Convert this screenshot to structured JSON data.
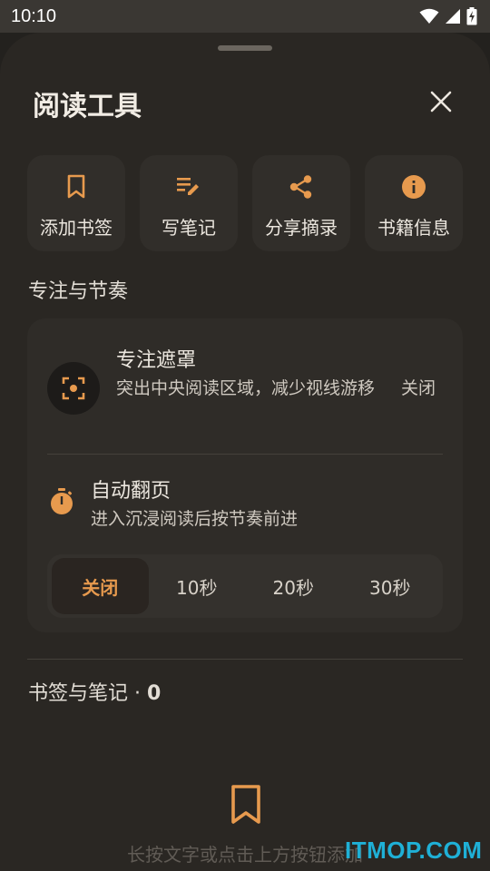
{
  "status_bar": {
    "time": "10:10"
  },
  "sheet": {
    "title": "阅读工具"
  },
  "tools": [
    {
      "label": "添加书签",
      "icon": "bookmark-icon"
    },
    {
      "label": "写笔记",
      "icon": "edit-note-icon"
    },
    {
      "label": "分享摘录",
      "icon": "share-icon"
    },
    {
      "label": "书籍信息",
      "icon": "info-icon"
    }
  ],
  "focus_section": {
    "title": "专注与节奏",
    "mask": {
      "title": "专注遮罩",
      "desc": "突出中央阅读区域，减少视线游移",
      "toggle": "关闭"
    },
    "auto_page": {
      "title": "自动翻页",
      "desc": "进入沉浸阅读后按节奏前进",
      "options": [
        "关闭",
        "10秒",
        "20秒",
        "30秒"
      ],
      "selected": "关闭"
    }
  },
  "bookmarks_section": {
    "title": "书签与笔记 · ",
    "count": "0",
    "empty_hint": "长按文字或点击上方按钮添加"
  },
  "watermark": "ITMOP.COM",
  "colors": {
    "accent": "#e79a4e",
    "sheet_bg": "#2a2723",
    "card_bg": "#312e2a"
  }
}
